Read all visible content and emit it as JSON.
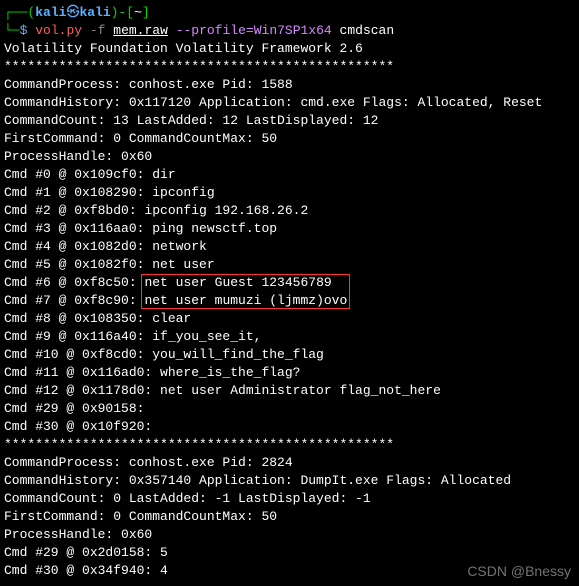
{
  "prompt": {
    "user": "kali",
    "host": "kali",
    "path": "~",
    "symbol": "$"
  },
  "command": {
    "prog": "vol.py",
    "flag_f": "-f",
    "file": "mem.raw",
    "profile_flag": "--profile=Win7SP1x64",
    "subcmd": "cmdscan"
  },
  "output": {
    "banner": "Volatility Foundation Volatility Framework 2.6",
    "stars": "**************************************************",
    "block1": {
      "l1": "CommandProcess: conhost.exe Pid: 1588",
      "l2": "CommandHistory: 0x117120 Application: cmd.exe Flags: Allocated, Reset",
      "l3": "CommandCount: 13 LastAdded: 12 LastDisplayed: 12",
      "l4": "FirstCommand: 0 CommandCountMax: 50",
      "l5": "ProcessHandle: 0x60",
      "c0": "Cmd #0 @ 0x109cf0: dir",
      "c1": "Cmd #1 @ 0x108290: ipconfig",
      "c2": "Cmd #2 @ 0xf8bd0: ipconfig 192.168.26.2",
      "c3": "Cmd #3 @ 0x116aa0: ping newsctf.top",
      "c4": "Cmd #4 @ 0x1082d0: network",
      "c5": "Cmd #5 @ 0x1082f0: net user",
      "c6_pre": "Cmd #6 @ 0xf8c50: ",
      "c6_hl": "net user Guest 123456789",
      "c7_pre": "Cmd #7 @ 0xf8c90: ",
      "c7_hl": "net user mumuzi (ljmmz)ovo",
      "c8": "Cmd #8 @ 0x108350: clear",
      "c9": "Cmd #9 @ 0x116a40: if_you_see_it,",
      "c10": "Cmd #10 @ 0xf8cd0: you_will_find_the_flag",
      "c11": "Cmd #11 @ 0x116ad0: where_is_the_flag?",
      "c12": "Cmd #12 @ 0x1178d0: net user Administrator flag_not_here",
      "c29": "Cmd #29 @ 0x90158:",
      "c30": "Cmd #30 @ 0x10f920:"
    },
    "block2": {
      "l1": "CommandProcess: conhost.exe Pid: 2824",
      "l2": "CommandHistory: 0x357140 Application: DumpIt.exe Flags: Allocated",
      "l3": "CommandCount: 0 LastAdded: -1 LastDisplayed: -1",
      "l4": "FirstCommand: 0 CommandCountMax: 50",
      "l5": "ProcessHandle: 0x60",
      "c29": "Cmd #29 @ 0x2d0158: 5",
      "c30": "Cmd #30 @ 0x34f940: 4"
    }
  },
  "watermark": "CSDN @Bnessy"
}
